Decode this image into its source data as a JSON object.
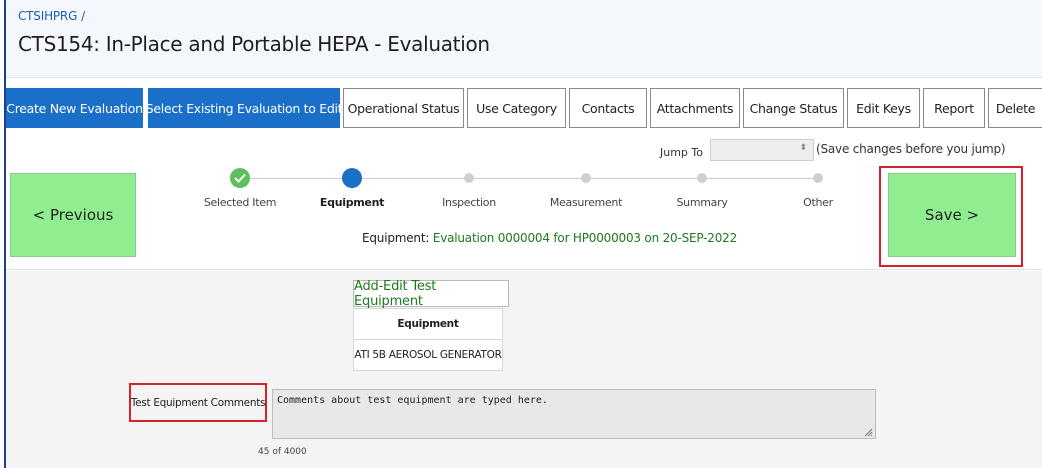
{
  "header": {
    "breadcrumb": "CTSIHPRG",
    "breadcrumb_sep": "/",
    "title": "CTS154: In-Place and Portable HEPA - Evaluation"
  },
  "toolbar": {
    "buttons": [
      {
        "label": "Create New Evaluation",
        "style": "primary"
      },
      {
        "label": "Select Existing Evaluation to Edit",
        "style": "primary"
      },
      {
        "label": "Operational Status",
        "style": "secondary"
      },
      {
        "label": "Use Category",
        "style": "secondary"
      },
      {
        "label": "Contacts",
        "style": "secondary"
      },
      {
        "label": "Attachments",
        "style": "secondary"
      },
      {
        "label": "Change Status",
        "style": "secondary"
      },
      {
        "label": "Edit Keys",
        "style": "secondary"
      },
      {
        "label": "Report",
        "style": "secondary"
      },
      {
        "label": "Delete",
        "style": "secondary"
      }
    ]
  },
  "jump": {
    "label": "Jump To",
    "value": "",
    "note": "(Save changes before you jump)"
  },
  "wizard": {
    "previous_label": "< Previous",
    "save_label": "Save >",
    "steps": [
      {
        "label": "Selected Item",
        "state": "done"
      },
      {
        "label": "Equipment",
        "state": "current"
      },
      {
        "label": "Inspection",
        "state": "todo"
      },
      {
        "label": "Measurement",
        "state": "todo"
      },
      {
        "label": "Summary",
        "state": "todo"
      },
      {
        "label": "Other",
        "state": "todo"
      }
    ],
    "status_prefix": "Equipment:",
    "status_value": "Evaluation 0000004 for HP0000003 on 20-SEP-2022"
  },
  "equipment": {
    "add_edit_label": "Add-Edit Test Equipment",
    "column_header": "Equipment",
    "rows": [
      "ATI 5B AEROSOL GENERATOR"
    ]
  },
  "comments": {
    "label": "Test Equipment Comments",
    "value": "Comments about test equipment are typed here.",
    "counter": "45 of 4000"
  },
  "colors": {
    "primary_blue": "#1a6fc9",
    "save_green": "#90ee90",
    "highlight_red": "#d9202a",
    "status_green": "#1e7a1e"
  }
}
